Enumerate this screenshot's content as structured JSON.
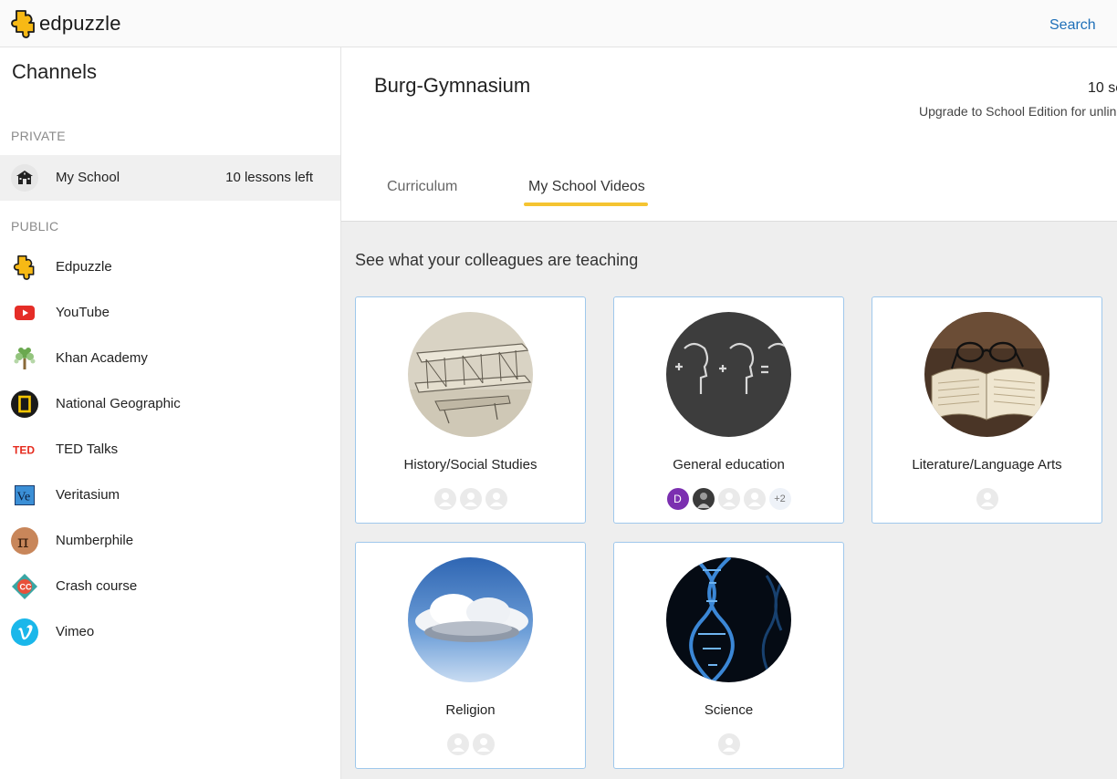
{
  "topbar": {
    "logo_text": "edpuzzle",
    "search_label": "Search"
  },
  "sidebar": {
    "title": "Channels",
    "private_label": "PRIVATE",
    "public_label": "PUBLIC",
    "private_items": [
      {
        "label": "My School",
        "meta": "10 lessons left",
        "icon": "school-icon"
      }
    ],
    "public_items": [
      {
        "label": "Edpuzzle",
        "icon": "edpuzzle-icon"
      },
      {
        "label": "YouTube",
        "icon": "youtube-icon"
      },
      {
        "label": "Khan Academy",
        "icon": "khan-academy-icon"
      },
      {
        "label": "National Geographic",
        "icon": "national-geographic-icon"
      },
      {
        "label": "TED Talks",
        "icon": "ted-icon"
      },
      {
        "label": "Veritasium",
        "icon": "veritasium-icon"
      },
      {
        "label": "Numberphile",
        "icon": "numberphile-icon"
      },
      {
        "label": "Crash course",
        "icon": "crash-course-icon"
      },
      {
        "label": "Vimeo",
        "icon": "vimeo-icon"
      }
    ]
  },
  "main": {
    "school_title": "Burg-Gymnasium",
    "lessons_count": "10 se",
    "upgrade_text": "Upgrade to School Edition for unlin",
    "tabs": [
      {
        "label": "Curriculum"
      },
      {
        "label": "My School Videos"
      }
    ],
    "section_heading": "See what your colleagues are teaching",
    "cards": [
      {
        "title": "History/Social Studies",
        "image": "airplane-image"
      },
      {
        "title": "General education",
        "image": "chalkboard-heads-image",
        "avatar_letter": "D",
        "more_count": "+2"
      },
      {
        "title": "Literature/Language Arts",
        "image": "book-glasses-image"
      },
      {
        "title": "Religion",
        "image": "cloud-sky-image"
      },
      {
        "title": "Science",
        "image": "dna-image"
      }
    ]
  },
  "colors": {
    "accent_yellow": "#f5c431",
    "link_blue": "#1e6fb8",
    "card_border": "#9fc8ec"
  }
}
